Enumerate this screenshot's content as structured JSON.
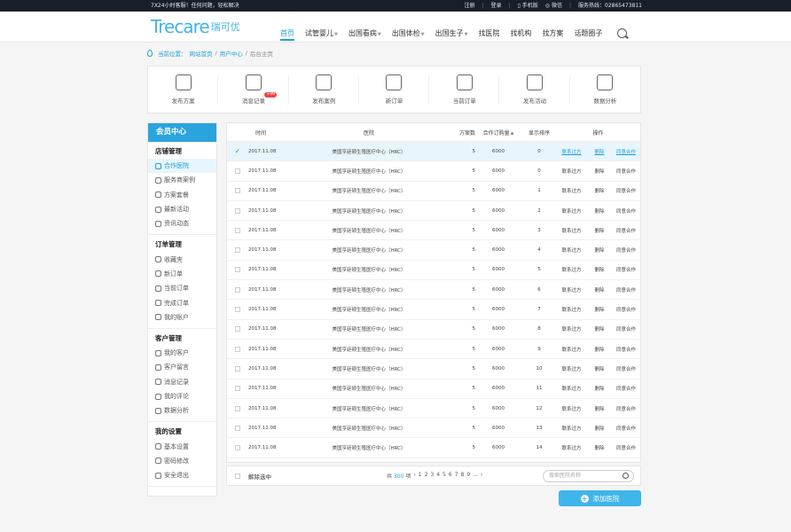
{
  "topbar": {
    "slogan": "7X24小时客服！任何问题，轻松解决",
    "register": "注册",
    "login": "登录",
    "mobile": "手机版",
    "wechat": "微信",
    "hotline": "服务热线：02865473811"
  },
  "logo": {
    "brand": "Trecare",
    "cn": "瑞可优"
  },
  "nav": [
    {
      "label": "首页",
      "caret": false
    },
    {
      "label": "试管婴儿",
      "caret": true
    },
    {
      "label": "出国看病",
      "caret": true
    },
    {
      "label": "出国体检",
      "caret": true
    },
    {
      "label": "出国生子",
      "caret": true
    },
    {
      "label": "找医院",
      "caret": false
    },
    {
      "label": "找机构",
      "caret": false
    },
    {
      "label": "找方案",
      "caret": false
    },
    {
      "label": "话题圈子",
      "caret": false
    }
  ],
  "breadcrumb": {
    "prefix": "当前位置：",
    "home": "网站首页",
    "sep": "/",
    "center": "用户中心",
    "current": "后台主页"
  },
  "quick": [
    {
      "label": "发布方案",
      "icon": "pen-icon"
    },
    {
      "label": "消息记录",
      "icon": "message-icon",
      "badge": "+99"
    },
    {
      "label": "发布案例",
      "icon": "star-doc-icon"
    },
    {
      "label": "新订单",
      "icon": "scroll-icon"
    },
    {
      "label": "当前订单",
      "icon": "clipboard-icon"
    },
    {
      "label": "发布活动",
      "icon": "balloon-icon"
    },
    {
      "label": "数据分析",
      "icon": "chart-icon"
    }
  ],
  "sidebar": {
    "title": "会员中心",
    "groups": [
      {
        "title": "店铺管理",
        "items": [
          "合作医院",
          "服务商案例",
          "方案套餐",
          "最新活动",
          "资讯动态"
        ]
      },
      {
        "title": "订单管理",
        "items": [
          "收藏夹",
          "新订单",
          "当前订单",
          "完成订单",
          "我的账户"
        ]
      },
      {
        "title": "客户管理",
        "items": [
          "我的客户",
          "客户留言",
          "消息记录",
          "我的评论",
          "数据分析"
        ]
      },
      {
        "title": "我的设置",
        "items": [
          "基本设置",
          "密码修改",
          "安全退出"
        ]
      }
    ]
  },
  "table": {
    "headers": [
      "时间",
      "医院",
      "方案数",
      "合作订购量",
      "显示排序",
      "操作"
    ],
    "rows": [
      {
        "date": "2017.11.08",
        "hospital": "美国亨廷顿生殖医疗中心（HRC）",
        "plans": "5",
        "orders": "6000",
        "sort": "0",
        "a1": "联系过方",
        "a2": "删除",
        "a3": "同意合作"
      },
      {
        "date": "2017.11.08",
        "hospital": "美国亨廷顿生殖医疗中心（HRC）",
        "plans": "5",
        "orders": "6000",
        "sort": "0",
        "a1": "联系过方",
        "a2": "删除",
        "a3": "同意合作"
      },
      {
        "date": "2017.11.08",
        "hospital": "美国亨廷顿生殖医疗中心（HRC）",
        "plans": "5",
        "orders": "6000",
        "sort": "1",
        "a1": "联系过方",
        "a2": "删除",
        "a3": "同意合作"
      },
      {
        "date": "2017.11.08",
        "hospital": "美国亨廷顿生殖医疗中心（HRC）",
        "plans": "5",
        "orders": "6000",
        "sort": "2",
        "a1": "联系过方",
        "a2": "删除",
        "a3": "同意合作"
      },
      {
        "date": "2017.11.08",
        "hospital": "美国亨廷顿生殖医疗中心（HRC）",
        "plans": "5",
        "orders": "6000",
        "sort": "3",
        "a1": "联系过方",
        "a2": "删除",
        "a3": "同意合作"
      },
      {
        "date": "2017.11.08",
        "hospital": "美国亨廷顿生殖医疗中心（HRC）",
        "plans": "5",
        "orders": "6000",
        "sort": "4",
        "a1": "联系过方",
        "a2": "删除",
        "a3": "同意合作"
      },
      {
        "date": "2017.11.08",
        "hospital": "美国亨廷顿生殖医疗中心（HRC）",
        "plans": "5",
        "orders": "6000",
        "sort": "5",
        "a1": "联系过方",
        "a2": "删除",
        "a3": "同意合作"
      },
      {
        "date": "2017.11.08",
        "hospital": "美国亨廷顿生殖医疗中心（HRC）",
        "plans": "5",
        "orders": "6000",
        "sort": "6",
        "a1": "联系过方",
        "a2": "删除",
        "a3": "同意合作"
      },
      {
        "date": "2017.11.08",
        "hospital": "美国亨廷顿生殖医疗中心（HRC）",
        "plans": "5",
        "orders": "6000",
        "sort": "7",
        "a1": "联系过方",
        "a2": "删除",
        "a3": "同意合作"
      },
      {
        "date": "2017.11.08",
        "hospital": "美国亨廷顿生殖医疗中心（HRC）",
        "plans": "5",
        "orders": "6000",
        "sort": "8",
        "a1": "联系过方",
        "a2": "删除",
        "a3": "同意合作"
      },
      {
        "date": "2017.11.08",
        "hospital": "美国亨廷顿生殖医疗中心（HRC）",
        "plans": "5",
        "orders": "6000",
        "sort": "9",
        "a1": "联系过方",
        "a2": "删除",
        "a3": "同意合作"
      },
      {
        "date": "2017.11.08",
        "hospital": "美国亨廷顿生殖医疗中心（HRC）",
        "plans": "5",
        "orders": "6000",
        "sort": "10",
        "a1": "联系过方",
        "a2": "删除",
        "a3": "同意合作"
      },
      {
        "date": "2017.11.08",
        "hospital": "美国亨廷顿生殖医疗中心（HRC）",
        "plans": "5",
        "orders": "6000",
        "sort": "11",
        "a1": "联系过方",
        "a2": "删除",
        "a3": "同意合作"
      },
      {
        "date": "2017.11.08",
        "hospital": "美国亨廷顿生殖医疗中心（HRC）",
        "plans": "5",
        "orders": "6000",
        "sort": "12",
        "a1": "联系过方",
        "a2": "删除",
        "a3": "同意合作"
      },
      {
        "date": "2017.11.08",
        "hospital": "美国亨廷顿生殖医疗中心（HRC）",
        "plans": "5",
        "orders": "6000",
        "sort": "13",
        "a1": "联系过方",
        "a2": "删除",
        "a3": "同意合作"
      },
      {
        "date": "2017.11.08",
        "hospital": "美国亨廷顿生殖医疗中心（HRC）",
        "plans": "5",
        "orders": "6000",
        "sort": "14",
        "a1": "联系过方",
        "a2": "删除",
        "a3": "同意合作"
      }
    ]
  },
  "footer": {
    "remove_selected": "解除选中",
    "total_prefix": "共",
    "total_count": "300",
    "total_suffix": "项",
    "prev": "‹",
    "pages": [
      "1",
      "2",
      "3",
      "4",
      "5",
      "6",
      "7",
      "8",
      "9",
      "..."
    ],
    "next": "›",
    "search_placeholder": "搜索医院名称"
  },
  "add_button": "添加医院"
}
